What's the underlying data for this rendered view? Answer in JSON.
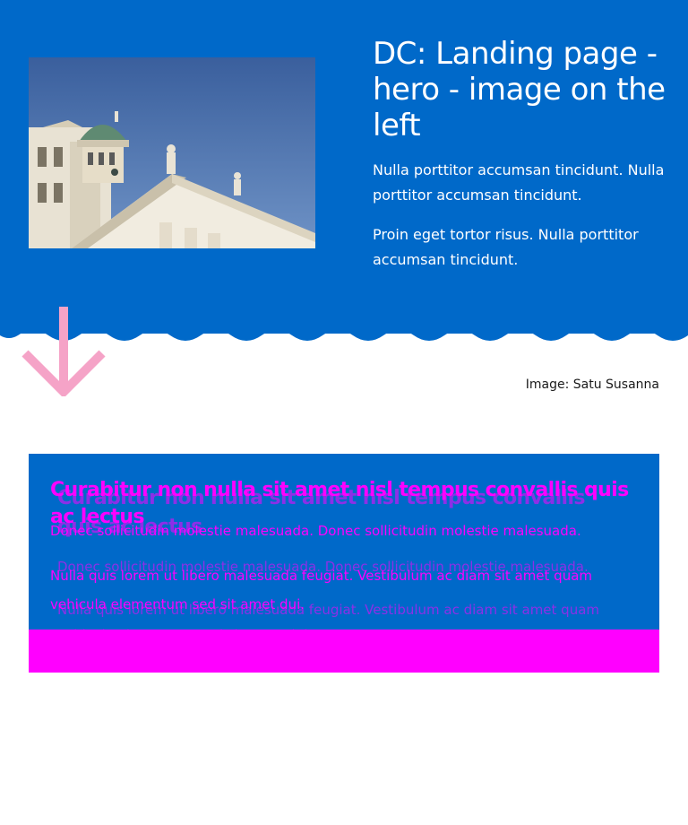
{
  "hero": {
    "title": "DC: Landing page - hero - image on the left",
    "paragraphs": [
      "Nulla porttitor accumsan tincidunt. Nulla porttitor accumsan tincidunt.",
      "Proin eget tortor risus. Nulla porttitor accumsan tincidunt."
    ],
    "image_caption": "Image: Satu Susanna",
    "background_color": "#0069c9",
    "image_subject": "cathedral-photo"
  },
  "decor": {
    "arrow_icon": "arrow-down-icon",
    "arrow_color": "#f5a3c7"
  },
  "promo": {
    "heading": "Curabitur non nulla sit amet nisl tempus convallis quis ac lectus",
    "paragraphs": [
      "Donec sollicitudin molestie malesuada. Donec sollicitudin molestie malesuada.",
      "Nulla quis lorem ut libero malesuada feugiat. Vestibulum ac diam sit amet quam vehicula elementum sed sit amet dui."
    ],
    "background_color": "#0069c9",
    "highlight_color": "#ff00ff"
  }
}
